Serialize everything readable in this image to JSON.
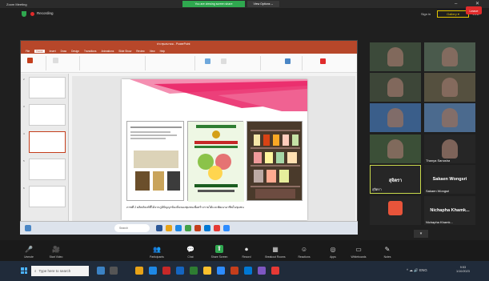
{
  "titlebar": {
    "app_title": "Zoom Meeting",
    "sharing_banner": "You are viewing screen share",
    "view_options": "View Options ⌄",
    "minimize": "–",
    "close": "✕"
  },
  "recording": {
    "label": "Recording",
    "sign_in": "Sign in",
    "gallery_label": "Gallery ▾",
    "view_label": "View"
  },
  "powerpoint": {
    "doc_title": "ประชุมสมาคม - PowerPoint",
    "tabs": [
      "File",
      "Home",
      "Insert",
      "Draw",
      "Design",
      "Transitions",
      "Animations",
      "Slide Show",
      "Review",
      "View",
      "Help"
    ],
    "active_tab": "Home",
    "thumb_numbers": [
      "2",
      "3",
      "4",
      "5",
      "6"
    ],
    "slide_caption": "ภาพที่ 2 ผลิตภัณฑ์ที่ได้จากภูมิปัญญาท้องถิ่นของชุมชนเพื่อสร้างรายได้และพัฒนาอาชีพในชุมชน",
    "status_left": "Slide 5 of 12",
    "status_right": "Notes   Comments   —  + 73%"
  },
  "inner_taskbar": {
    "search_text": "Search"
  },
  "participants": [
    {
      "name": "",
      "bg": "#3c4a3a"
    },
    {
      "name": "",
      "bg": "#4a5a4c"
    },
    {
      "name": "",
      "bg": "#3d4638"
    },
    {
      "name": "",
      "bg": "#55503f"
    },
    {
      "name": "",
      "bg": "#3a5e8a"
    },
    {
      "name": "",
      "bg": "#4b6a8e"
    },
    {
      "name": "",
      "bg": "#3b4f37"
    },
    {
      "name": "Thanya Sanosha",
      "bg": "#262626"
    },
    {
      "name": "สุจิตรา",
      "bg": "#262626",
      "center": "สุจิตรา",
      "highlight": true
    },
    {
      "name": "Sakaen Wongsri",
      "bg": "#262626",
      "center": "Sakaen Wongsri"
    },
    {
      "name": "",
      "bg": "#262626",
      "avatar": true
    },
    {
      "name": "Nichapha Khamk...",
      "bg": "#262626",
      "center": "Nichapha Khamk..."
    }
  ],
  "controls": [
    {
      "icon": "🎤",
      "label": "Unmute"
    },
    {
      "icon": "🎥",
      "label": "Start Video"
    },
    {
      "icon": "👥",
      "label": "Participants"
    },
    {
      "icon": "💬",
      "label": "Chat"
    },
    {
      "icon": "⬆",
      "label": "Share Screen"
    },
    {
      "icon": "⏺",
      "label": "Record"
    },
    {
      "icon": "▦",
      "label": "Breakout Rooms"
    },
    {
      "icon": "☺",
      "label": "Reactions"
    },
    {
      "icon": "◎",
      "label": "Apps"
    },
    {
      "icon": "▭",
      "label": "Whiteboards"
    },
    {
      "icon": "✎",
      "label": "Notes"
    }
  ],
  "leave_label": "Leave",
  "taskbar": {
    "search_placeholder": "Type here to search",
    "tray_text": "^ ☁ 🔊 ENG",
    "time": "9:53",
    "date": "1/10/2023"
  },
  "colors": {
    "ppt_accent": "#b7472a",
    "zoom_green": "#2fa84f",
    "leave_red": "#e02b2b",
    "highlight": "#c8d94c"
  }
}
